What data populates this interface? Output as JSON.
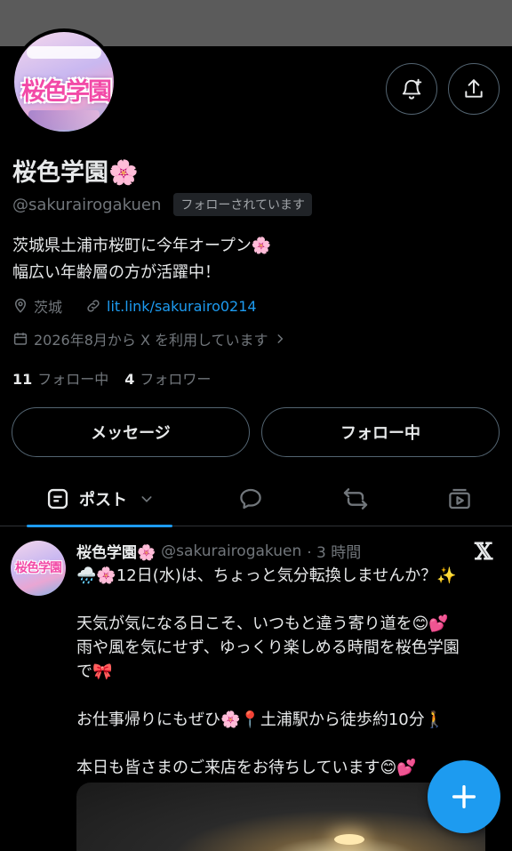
{
  "profile": {
    "name": "桜色学園🌸",
    "handle": "@sakurairogakuen",
    "follows_you": "フォローされています",
    "avatar_logo_text": "桜色学園",
    "bio_line1": "茨城県土浦市桜町に今年オープン🌸",
    "bio_line2": "幅広い年齢層の方が活躍中！",
    "location": "茨城",
    "link": "lit.link/sakurairo0214",
    "joined": "2026年8月から X を利用しています",
    "following_count": "11",
    "following_label": "フォロー中",
    "followers_count": "4",
    "followers_label": "フォロワー"
  },
  "actions": {
    "message_label": "メッセージ",
    "follow_label": "フォロー中"
  },
  "tabs": {
    "posts_label": "ポスト"
  },
  "post": {
    "name": "桜色学園🌸",
    "handle": "@sakurairogakuen",
    "time": "· 3 時間",
    "line1": "🌧️🌸12日(水)は、ちょっと気分転換しませんか？✨",
    "line2": "天気が気になる日こそ、いつもと違う寄り道を😊💕",
    "line3": "雨や風を気にせず、ゆっくり楽しめる時間を桜色学園",
    "line4": "で🎀",
    "line5": "お仕事帰りにもぜひ🌸📍土浦駅から徒歩約10分🚶",
    "line6": "本日も皆さまのご来店をお待ちしています😊💕"
  },
  "colors": {
    "background": "#000000",
    "accent": "#1d9bf0",
    "muted": "#71767b",
    "border": "#536471"
  },
  "icons": [
    "bell-plus-icon",
    "share-icon",
    "location-icon",
    "link-icon",
    "calendar-icon",
    "chevron-right-icon",
    "posts-tab-icon",
    "chevron-down-icon",
    "replies-icon",
    "repost-icon",
    "media-icon",
    "x-logo-icon",
    "compose-plus-icon"
  ]
}
